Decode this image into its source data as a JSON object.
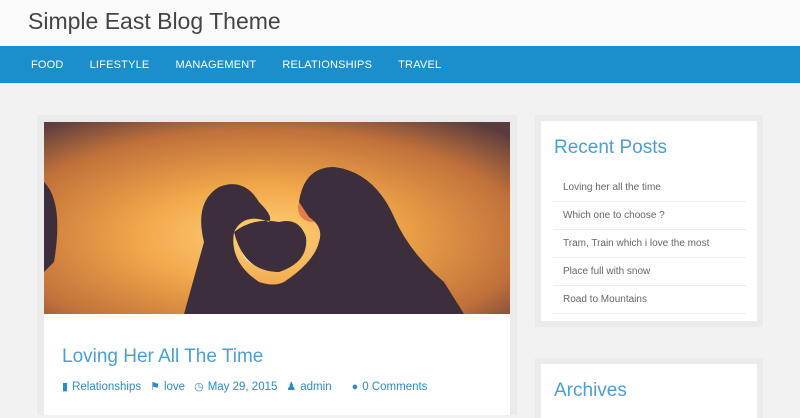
{
  "site": {
    "title": "Simple East Blog Theme"
  },
  "nav": [
    "FOOD",
    "LIFESTYLE",
    "MANAGEMENT",
    "RELATIONSHIPS",
    "TRAVEL"
  ],
  "post": {
    "title": "Loving Her All The Time",
    "category": "Relationships",
    "tag": "love",
    "date": "May 29, 2015",
    "author": "admin",
    "comments": "0 Comments"
  },
  "sidebar": {
    "recent_title": "Recent Posts",
    "recent": [
      "Loving her all the time",
      "Which one to choose ?",
      "Tram, Train which i love the most",
      "Place full with snow",
      "Road to Mountains"
    ],
    "archives_title": "Archives"
  },
  "colors": {
    "accent": "#1a8fcb",
    "link": "#4a9fd5"
  }
}
